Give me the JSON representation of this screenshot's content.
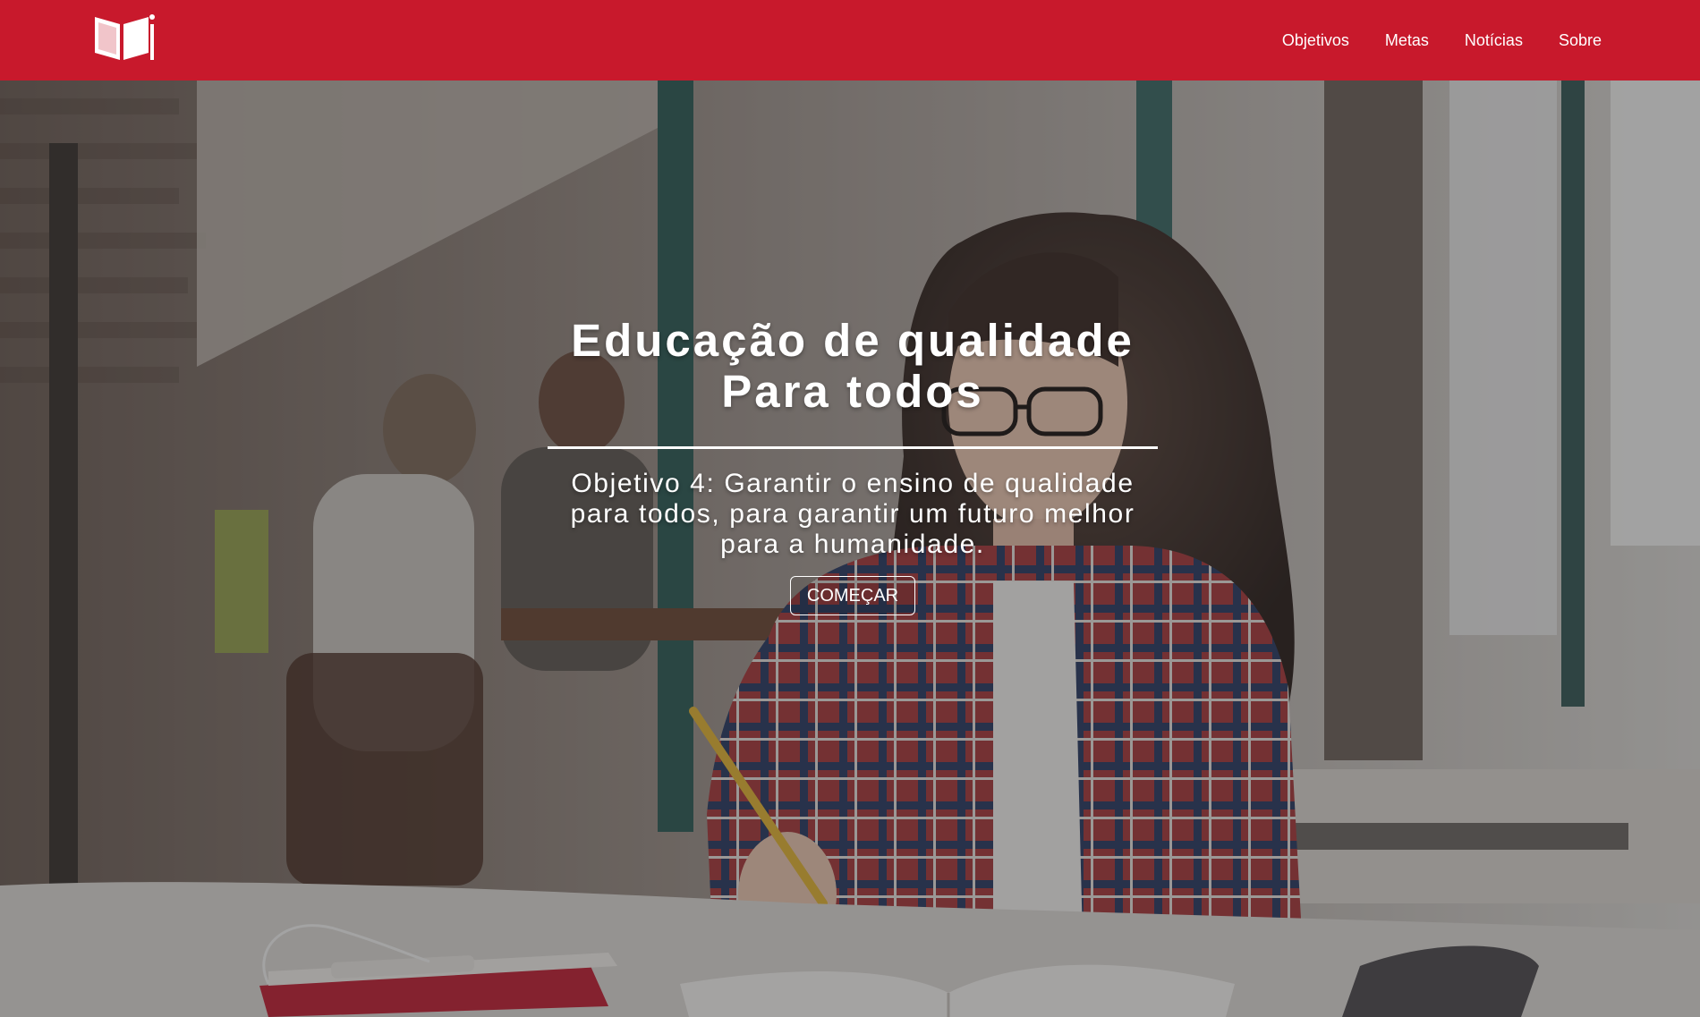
{
  "brand": {
    "color": "#c8192c",
    "logo_icon": "open-book-icon"
  },
  "nav": {
    "items": [
      {
        "label": "Objetivos"
      },
      {
        "label": "Metas"
      },
      {
        "label": "Notícias"
      },
      {
        "label": "Sobre"
      }
    ]
  },
  "hero": {
    "title_line1": "Educação de qualidade",
    "title_line2": "Para todos",
    "subtitle": "Objetivo 4: Garantir o ensino de qualidade para todos, para garantir um futuro melhor para a humanidade.",
    "cta_label": "COMEÇAR",
    "background": "photo: student writing in notebook at library table"
  }
}
